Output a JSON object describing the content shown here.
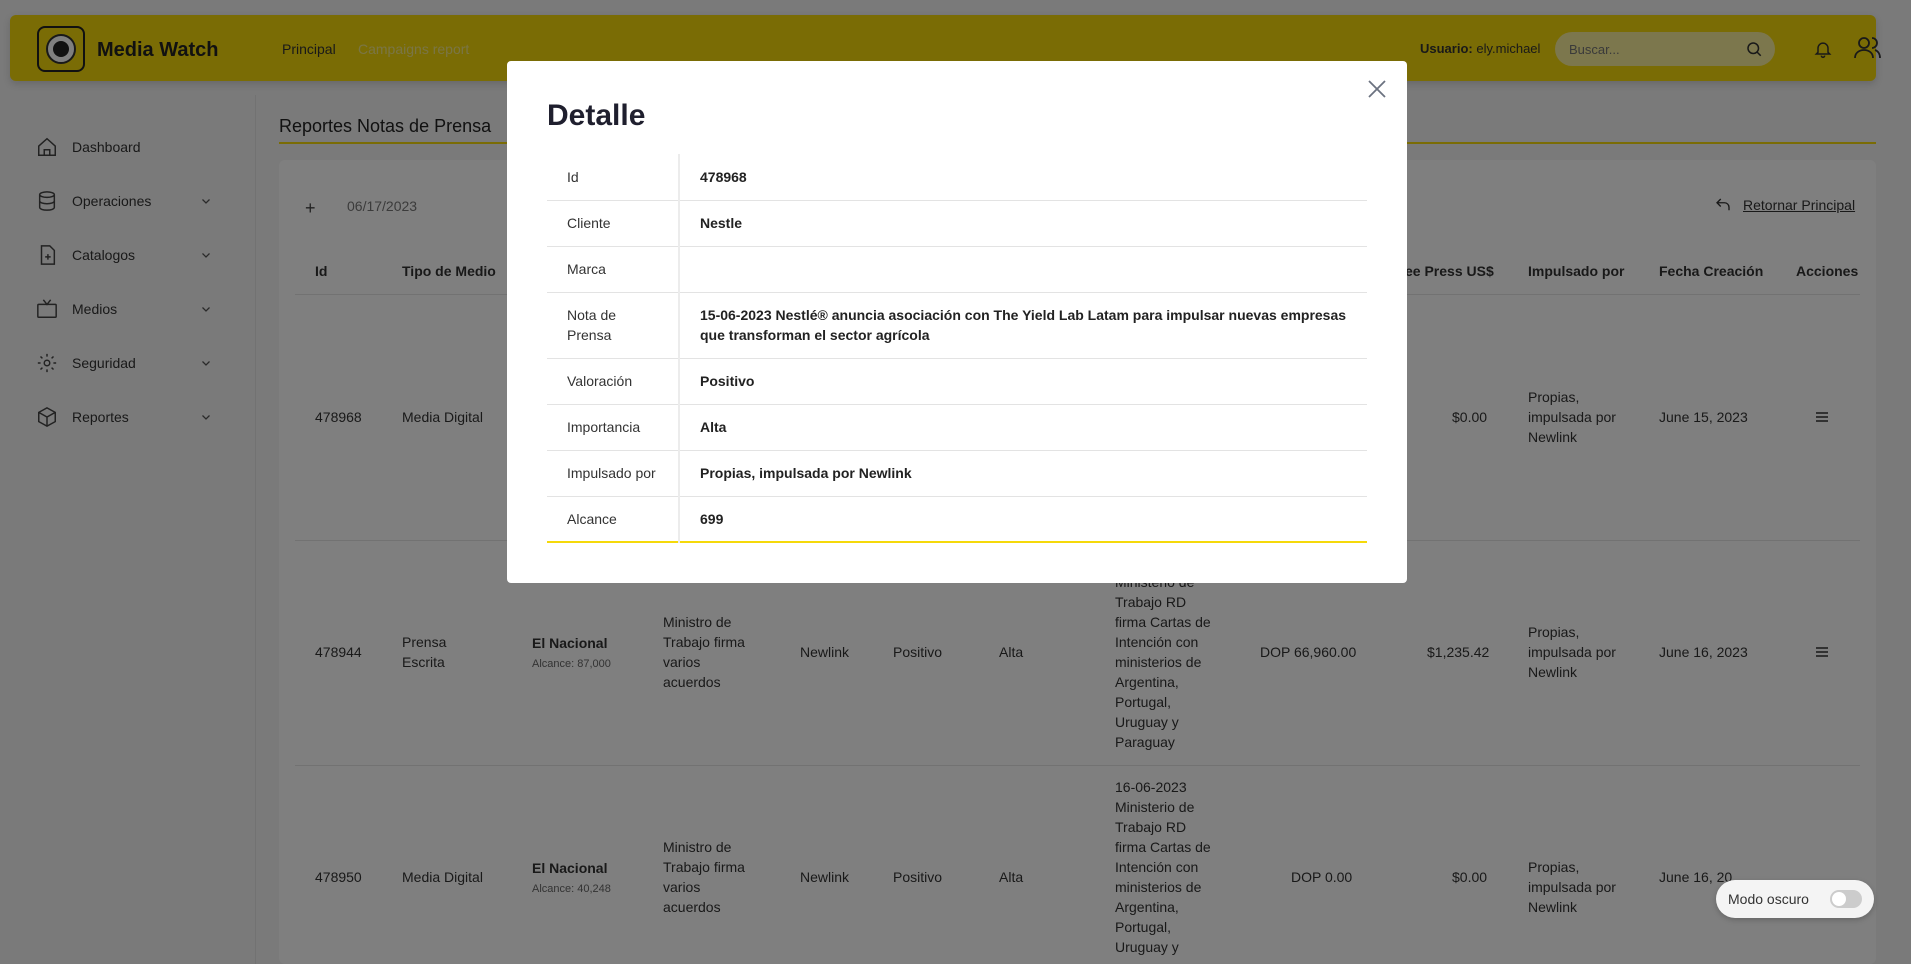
{
  "app": {
    "title": "Media Watch"
  },
  "header": {
    "nav": [
      "Principal",
      "Campaigns report"
    ],
    "user_prefix": "Usuario:",
    "user_name": "ely.michael",
    "search_placeholder": "Buscar..."
  },
  "sidebar": {
    "items": [
      {
        "label": "Dashboard",
        "icon": "home-icon"
      },
      {
        "label": "Operaciones",
        "icon": "database-icon"
      },
      {
        "label": "Catalogos",
        "icon": "file-plus-icon"
      },
      {
        "label": "Medios",
        "icon": "tv-icon"
      },
      {
        "label": "Seguridad",
        "icon": "gear-icon"
      },
      {
        "label": "Reportes",
        "icon": "box-icon"
      }
    ]
  },
  "main": {
    "title": "Reportes Notas de Prensa",
    "date_value": "06/17/2023",
    "return_label": "Retornar Principal",
    "columns": [
      "Id",
      "Tipo de Medio",
      "ee Press US$",
      "Impulsado por",
      "Fecha Creación",
      "Acciones"
    ],
    "rows": [
      {
        "id": "478968",
        "tipo": "Media Digital",
        "press_usd": "$0.00",
        "impulsado": "Propias, impulsada por Newlink",
        "fecha": "June 15, 2023"
      },
      {
        "id": "478944",
        "tipo": "Prensa Escrita",
        "medio": "El Nacional",
        "alcance": "Alcance: 87,000",
        "tema": "Ministro de Trabajo firma varios acuerdos",
        "cliente": "Newlink",
        "valoracion": "Positivo",
        "importancia": "Alta",
        "nota": "Ministerio de Trabajo RD firma Cartas de Intención con ministerios de Argentina, Portugal, Uruguay y Paraguay",
        "press_dop": "DOP 66,960.00",
        "press_usd": "$1,235.42",
        "impulsado": "Propias, impulsada por Newlink",
        "fecha": "June 16, 2023"
      },
      {
        "id": "478950",
        "tipo": "Media Digital",
        "medio": "El Nacional",
        "alcance": "Alcance: 40,248",
        "tema": "Ministro de Trabajo firma varios acuerdos",
        "cliente": "Newlink",
        "valoracion": "Positivo",
        "importancia": "Alta",
        "nota": "16-06-2023 Ministerio de Trabajo RD firma Cartas de Intención con ministerios de Argentina, Portugal, Uruguay y",
        "press_dop": "DOP 0.00",
        "press_usd": "$0.00",
        "impulsado": "Propias, impulsada por Newlink",
        "fecha": "June 16, 20"
      }
    ]
  },
  "dark_mode": {
    "label": "Modo oscuro"
  },
  "modal": {
    "title": "Detalle",
    "rows": [
      {
        "key": "Id",
        "value": "478968"
      },
      {
        "key": "Cliente",
        "value": "Nestle"
      },
      {
        "key": "Marca",
        "value": ""
      },
      {
        "key": "Nota de Prensa",
        "value": "15-06-2023 Nestlé® anuncia asociación con The Yield Lab Latam para impulsar nuevas empresas que transforman el sector agrícola"
      },
      {
        "key": "Valoración",
        "value": "Positivo"
      },
      {
        "key": "Importancia",
        "value": "Alta"
      },
      {
        "key": "Impulsado por",
        "value": "Propias, impulsada por Newlink"
      },
      {
        "key": "Alcance",
        "value": "699"
      }
    ]
  },
  "colors": {
    "accent": "#f5d90a",
    "overlay": "rgba(0,0,0,0.5)"
  }
}
